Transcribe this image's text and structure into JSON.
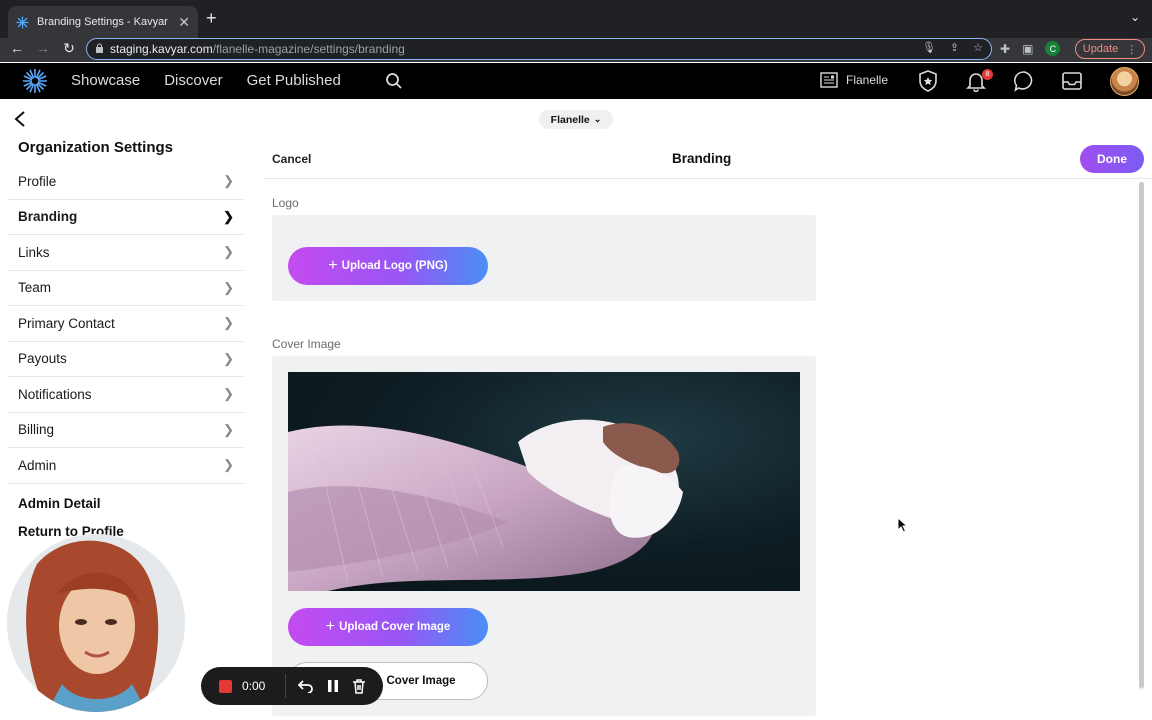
{
  "browser": {
    "tab_title": "Branding Settings - Kavyar",
    "url_host": "staging.kavyar.com",
    "url_path": "/flanelle-magazine/settings/branding",
    "profile_initial": "C",
    "update_label": "Update"
  },
  "header": {
    "nav": [
      "Showcase",
      "Discover",
      "Get Published"
    ],
    "org_name": "Flanelle",
    "notification_count": "8"
  },
  "sidebar": {
    "title": "Organization Settings",
    "items": [
      {
        "label": "Profile",
        "active": false
      },
      {
        "label": "Branding",
        "active": true
      },
      {
        "label": "Links",
        "active": false
      },
      {
        "label": "Team",
        "active": false
      },
      {
        "label": "Primary Contact",
        "active": false
      },
      {
        "label": "Payouts",
        "active": false
      },
      {
        "label": "Notifications",
        "active": false
      },
      {
        "label": "Billing",
        "active": false
      },
      {
        "label": "Admin",
        "active": false
      }
    ],
    "admin_detail": "Admin Detail",
    "return_to_profile": "Return to Profile"
  },
  "main": {
    "org_pill": "Flanelle",
    "cancel": "Cancel",
    "title": "Branding",
    "done": "Done",
    "logo_label": "Logo",
    "upload_logo": "Upload Logo (PNG)",
    "cover_label": "Cover Image",
    "upload_cover": "Upload Cover Image",
    "remove_cover": "Cover Image"
  },
  "recorder": {
    "time": "0:00"
  },
  "colors": {
    "accent_purple": "#a04ef0",
    "accent_blue": "#4a8ff5",
    "record_red": "#e53935"
  }
}
